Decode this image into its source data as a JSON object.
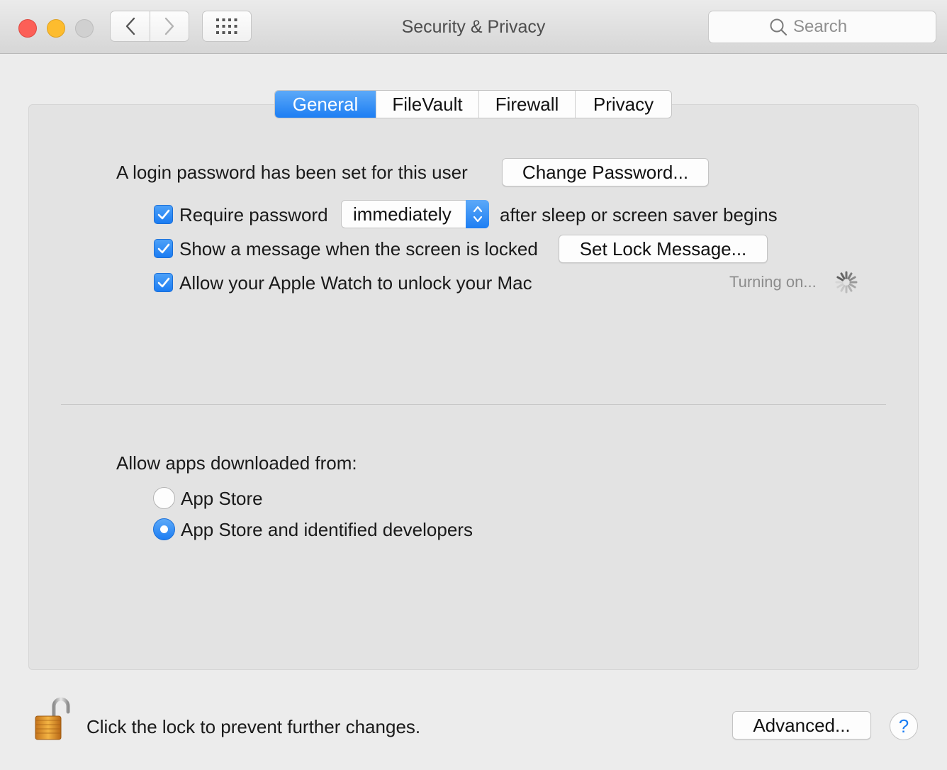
{
  "window": {
    "title": "Security & Privacy",
    "search_placeholder": "Search"
  },
  "tabs": [
    {
      "label": "General",
      "active": true
    },
    {
      "label": "FileVault",
      "active": false
    },
    {
      "label": "Firewall",
      "active": false
    },
    {
      "label": "Privacy",
      "active": false
    }
  ],
  "general": {
    "login_text": "A login password has been set for this user",
    "change_password_label": "Change Password...",
    "require_password": {
      "label": "Require password",
      "checked": true
    },
    "require_select_value": "immediately",
    "after_sleep_text": "after sleep or screen saver begins",
    "show_message": {
      "label": "Show a message when the screen is locked",
      "checked": true
    },
    "set_lock_message_label": "Set Lock Message...",
    "apple_watch": {
      "label": "Allow your Apple Watch to unlock your Mac",
      "checked": true
    },
    "status_text": "Turning on...",
    "allow_apps_heading": "Allow apps downloaded from:",
    "radio_options": [
      {
        "label": "App Store",
        "selected": false
      },
      {
        "label": "App Store and identified developers",
        "selected": true
      }
    ]
  },
  "footer": {
    "lock_text": "Click the lock to prevent further changes.",
    "advanced_label": "Advanced...",
    "help_label": "?"
  },
  "colors": {
    "accent": "#1d7ef3",
    "window_bg": "#ececec",
    "panel_bg": "#e3e3e3"
  },
  "icons": [
    "chevron-left-icon",
    "chevron-right-icon",
    "grid-icon",
    "search-icon",
    "checkmark-icon",
    "updown-arrows-icon",
    "spinner-icon",
    "unlocked-padlock-icon"
  ]
}
